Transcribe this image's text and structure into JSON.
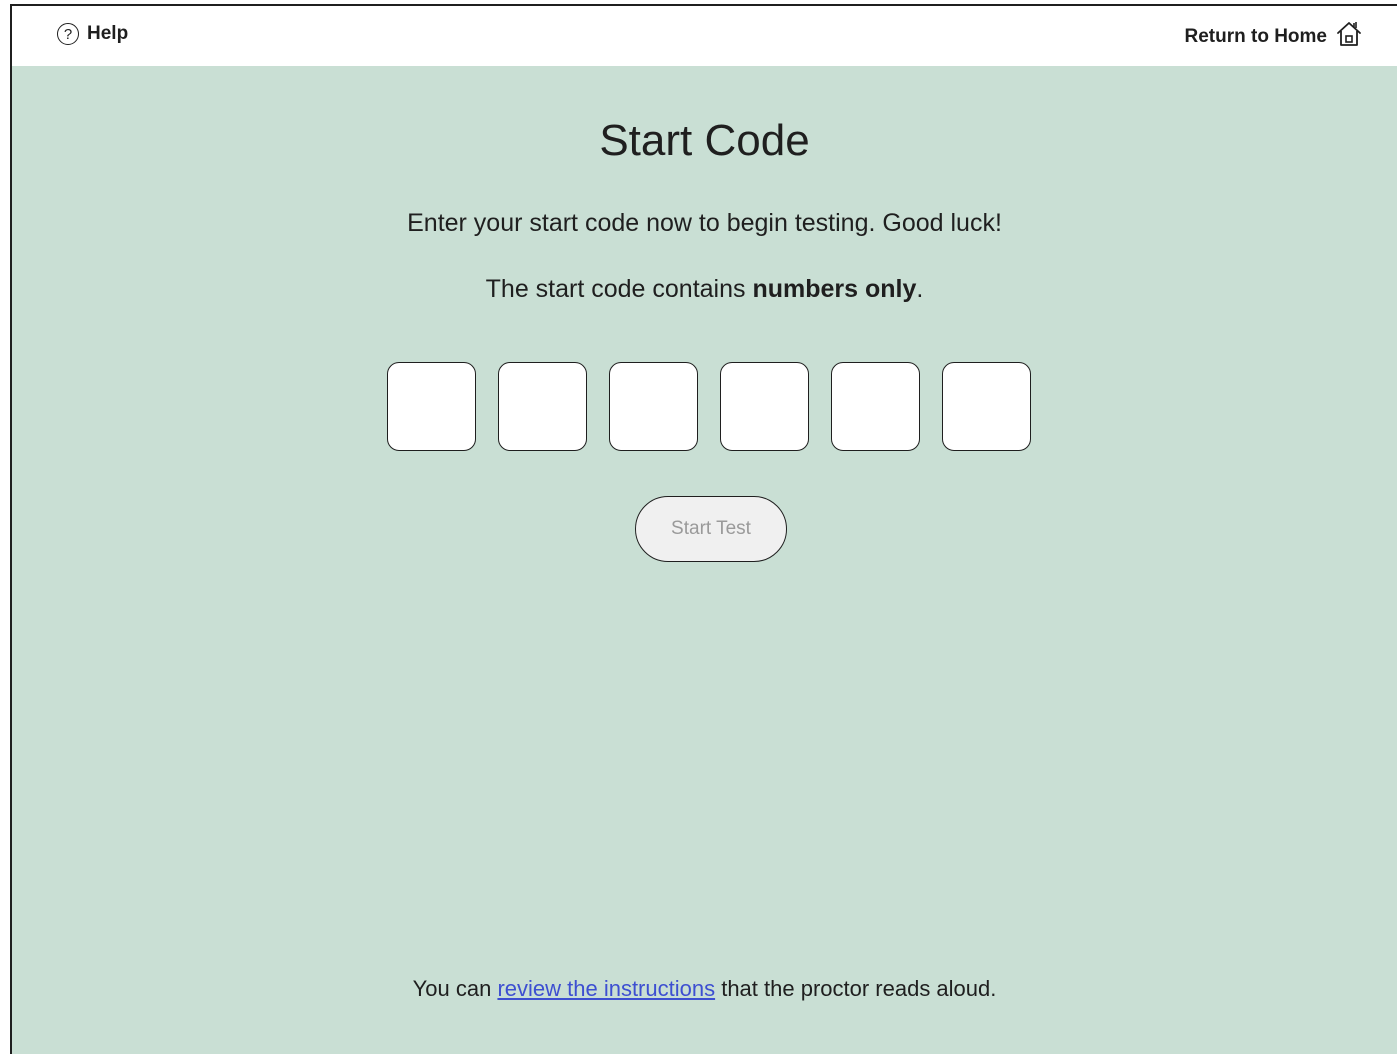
{
  "topbar": {
    "help_label": "Help",
    "help_icon_glyph": "?",
    "home_label": "Return to Home"
  },
  "main": {
    "title": "Start Code",
    "instruction_1": "Enter your start code now to begin testing. Good luck!",
    "instruction_2_prefix": "The start code contains ",
    "instruction_2_bold": "numbers only",
    "instruction_2_suffix": ".",
    "code_boxes": [
      "",
      "",
      "",
      "",
      "",
      ""
    ],
    "start_button_label": "Start Test"
  },
  "footer": {
    "prefix": "You can ",
    "link_text": "review the instructions",
    "suffix": " that the proctor reads aloud."
  },
  "colors": {
    "background": "#c9dfd4",
    "link": "#3d4fd1",
    "button_disabled_text": "#9a9a9a"
  },
  "icons": {
    "help": "question-circle-icon",
    "home": "house-icon"
  }
}
